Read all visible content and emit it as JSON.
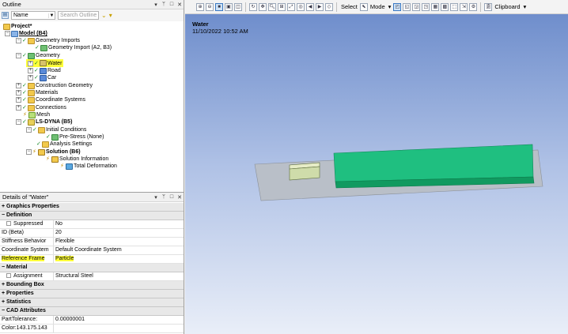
{
  "outline": {
    "title": "Outline",
    "name_select": "Name",
    "search_placeholder": "Search Outline",
    "tree": {
      "project": "Project*",
      "model": "Model (B4)",
      "geometry_imports": "Geometry Imports",
      "geometry_import": "Geometry Import (A2, B3)",
      "geometry": "Geometry",
      "water": "Water",
      "road": "Road",
      "car": "Car",
      "construction_geometry": "Construction Geometry",
      "materials": "Materials",
      "coordinate_systems": "Coordinate Systems",
      "connections": "Connections",
      "mesh": "Mesh",
      "lsdyna": "LS-DYNA (B5)",
      "initial_conditions": "Initial Conditions",
      "pre_stress": "Pre-Stress (None)",
      "analysis_settings": "Analysis Settings",
      "solution": "Solution (B6)",
      "solution_information": "Solution Information",
      "total_deformation": "Total Deformation"
    }
  },
  "details": {
    "title": "Details of \"Water\"",
    "rows": {
      "graphics_properties": "Graphics Properties",
      "definition": "Definition",
      "suppressed_label": "Suppressed",
      "suppressed_value": "No",
      "id_label": "ID (Beta)",
      "id_value": "20",
      "stiffness_label": "Stiffness Behavior",
      "stiffness_value": "Flexible",
      "coord_label": "Coordinate System",
      "coord_value": "Default Coordinate System",
      "refframe_label": "Reference Frame",
      "refframe_value": "Particle",
      "material": "Material",
      "assignment_label": "Assignment",
      "assignment_value": "Structural Steel",
      "bounding_box": "Bounding Box",
      "properties": "Properties",
      "statistics": "Statistics",
      "cad_attributes": "CAD Attributes",
      "part_tolerance_label": "PartTolerance:",
      "part_tolerance_value": "0.00000001",
      "color_label": "Color:143.175.143"
    }
  },
  "toolbar": {
    "select": "Select",
    "mode": "Mode",
    "clipboard": "Clipboard"
  },
  "viewport": {
    "title": "Water",
    "date": "11/10/2022 10:52 AM"
  },
  "colors": {
    "highlight": "#ffff3a",
    "car_green": "#1fbf80",
    "water_body": "#c8d8a8",
    "road": "#b8bec8"
  },
  "icons": [
    "collapse-icon",
    "expand-icon",
    "check-icon",
    "folder-icon",
    "model-icon",
    "geometry-icon",
    "body-icon",
    "mesh-icon",
    "solution-icon",
    "result-icon",
    "pin-icon",
    "close-icon",
    "filter-icon",
    "zoom-in-icon",
    "zoom-out-icon",
    "rotate-icon",
    "pan-icon",
    "fit-icon",
    "clipboard-icon"
  ]
}
